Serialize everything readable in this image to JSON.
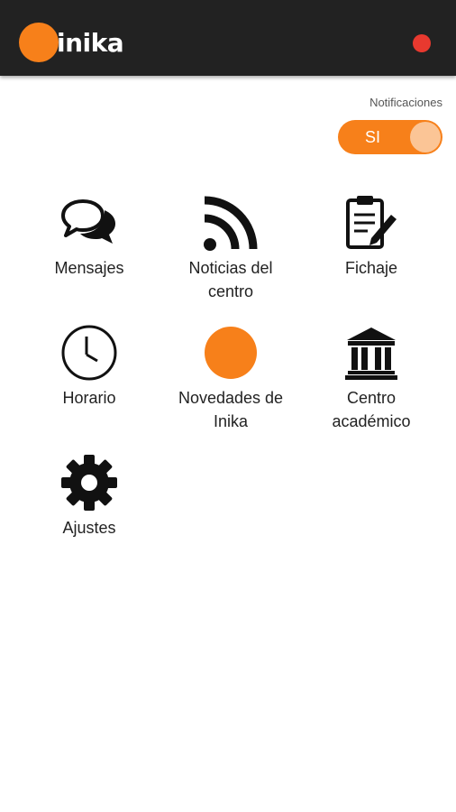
{
  "app": {
    "name": "inika",
    "brand_color": "#f7801a",
    "header_color": "#222222",
    "status_dot_color": "#e8392f"
  },
  "notifications": {
    "label": "Notificaciones",
    "toggle_value": "SI",
    "enabled": true
  },
  "menu": [
    {
      "label_line1": "Mensajes",
      "label_line2": "",
      "icon": "chat-bubbles-icon"
    },
    {
      "label_line1": "Noticias del",
      "label_line2": "centro",
      "icon": "rss-icon"
    },
    {
      "label_line1": "Fichaje",
      "label_line2": "",
      "icon": "clipboard-edit-icon"
    },
    {
      "label_line1": "Horario",
      "label_line2": "",
      "icon": "clock-icon"
    },
    {
      "label_line1": "Novedades de",
      "label_line2": "Inika",
      "icon": "orange-circle-icon"
    },
    {
      "label_line1": "Centro",
      "label_line2": "académico",
      "icon": "institution-icon"
    },
    {
      "label_line1": "Ajustes",
      "label_line2": "",
      "icon": "gear-icon"
    }
  ]
}
